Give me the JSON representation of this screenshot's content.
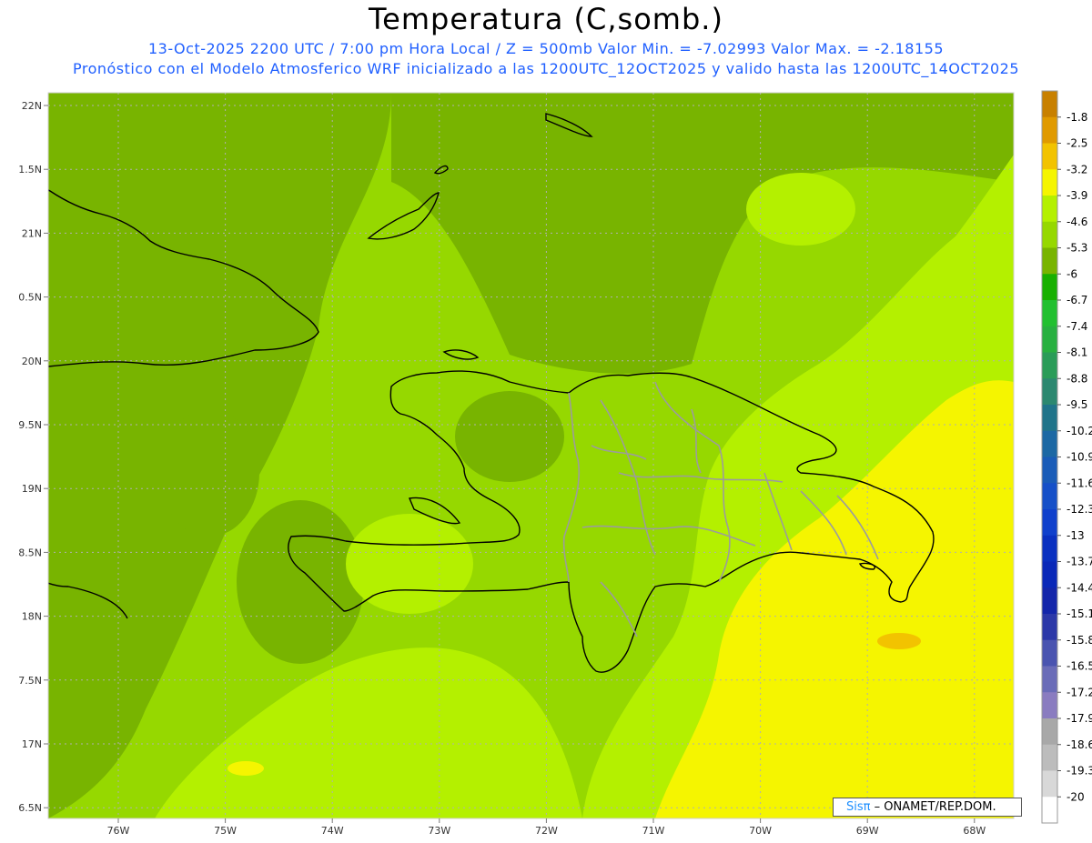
{
  "title": "Temperatura (C,somb.)",
  "subtitle_line1": "13-Oct-2025  2200 UTC / 7:00 pm Hora Local / Z = 500mb  Valor Min. = -7.02993  Valor Max. = -2.18155",
  "subtitle_line2": "Pronóstico con el Modelo Atmosferico WRF inicializado a las 1200UTC_12OCT2025 y valido hasta las  1200UTC_14OCT2025",
  "credit": {
    "logo": "Sisπ",
    "text": " – ONAMET/REP.DOM."
  },
  "lat_labels": [
    "22N",
    "1.5N",
    "21N",
    "0.5N",
    "20N",
    "9.5N",
    "19N",
    "8.5N",
    "18N",
    "7.5N",
    "17N",
    "6.5N"
  ],
  "lon_labels": [
    "76W",
    "75W",
    "74W",
    "73W",
    "72W",
    "71W",
    "70W",
    "69W",
    "68W"
  ],
  "colorbar": {
    "labels": [
      "-1.8",
      "-2.5",
      "-3.2",
      "-3.9",
      "-4.6",
      "-5.3",
      "-6",
      "-6.7",
      "-7.4",
      "-8.1",
      "-8.8",
      "-9.5",
      "-10.2",
      "-10.9",
      "-11.6",
      "-12.3",
      "-13",
      "-13.7",
      "-14.4",
      "-15.1",
      "-15.8",
      "-16.5",
      "-17.2",
      "-17.9",
      "-18.6",
      "-19.3",
      "-20"
    ],
    "colors": [
      "#c88000",
      "#e09a00",
      "#f2c300",
      "#f5f500",
      "#b4f000",
      "#96d800",
      "#78b400",
      "#18b000",
      "#22c030",
      "#28b040",
      "#2a9c58",
      "#2c8870",
      "#20748a",
      "#1c68a4",
      "#1a5cb8",
      "#1650c8",
      "#1040cc",
      "#0a30c0",
      "#0a28b8",
      "#1426aa",
      "#2c38a8",
      "#4a54b0",
      "#6a6cb8",
      "#8a7cc0",
      "#a8a8a8",
      "#bcbcbc",
      "#d8d8d8",
      "#ffffff"
    ]
  },
  "field_colors": {
    "dark_green": "#78b400",
    "mid_green": "#96d800",
    "light_green": "#b4f000",
    "yellow": "#f5f500",
    "orange": "#f2c300"
  }
}
